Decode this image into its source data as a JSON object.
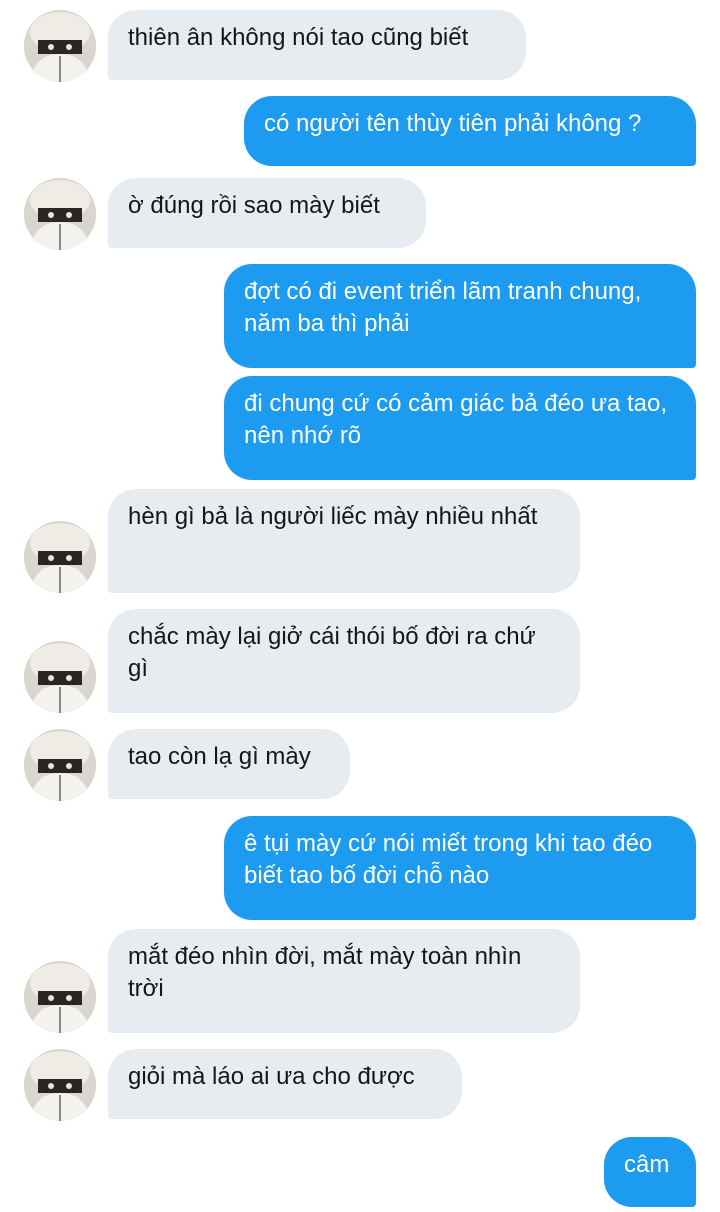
{
  "conversation": {
    "messages": [
      {
        "side": "in",
        "text": "thiên ân không nói tao cũng biết"
      },
      {
        "side": "out",
        "text": "có người tên thùy tiên phải không ?"
      },
      {
        "side": "in",
        "text": "ờ đúng rồi sao mày biết"
      },
      {
        "side": "out",
        "text": "đợt có đi event triển lãm tranh chung, năm ba thì phải"
      },
      {
        "side": "out",
        "text": "đi chung cứ có cảm giác bả đéo ưa tao, nên nhớ rõ"
      },
      {
        "side": "in",
        "text": "hèn gì bả là người liếc mày nhiều nhất"
      },
      {
        "side": "in",
        "text": "chắc mày lại giở cái thói bố đời ra chứ gì"
      },
      {
        "side": "in",
        "text": "tao còn lạ gì mày"
      },
      {
        "side": "out",
        "text": "ê tụi mày cứ nói miết trong khi tao đéo biết tao bố đời chỗ nào"
      },
      {
        "side": "in",
        "text": "mắt đéo nhìn đời, mắt mày toàn nhìn trời"
      },
      {
        "side": "in",
        "text": "giỏi mà láo ai ưa cho được"
      },
      {
        "side": "out",
        "text": "câm"
      }
    ]
  },
  "colors": {
    "incoming_bubble": "#e6ecf0",
    "outgoing_bubble": "#1d9bf0",
    "incoming_text": "#14171a",
    "outgoing_text": "#ffffff"
  },
  "icons": {
    "avatar": "avatar-icon"
  }
}
